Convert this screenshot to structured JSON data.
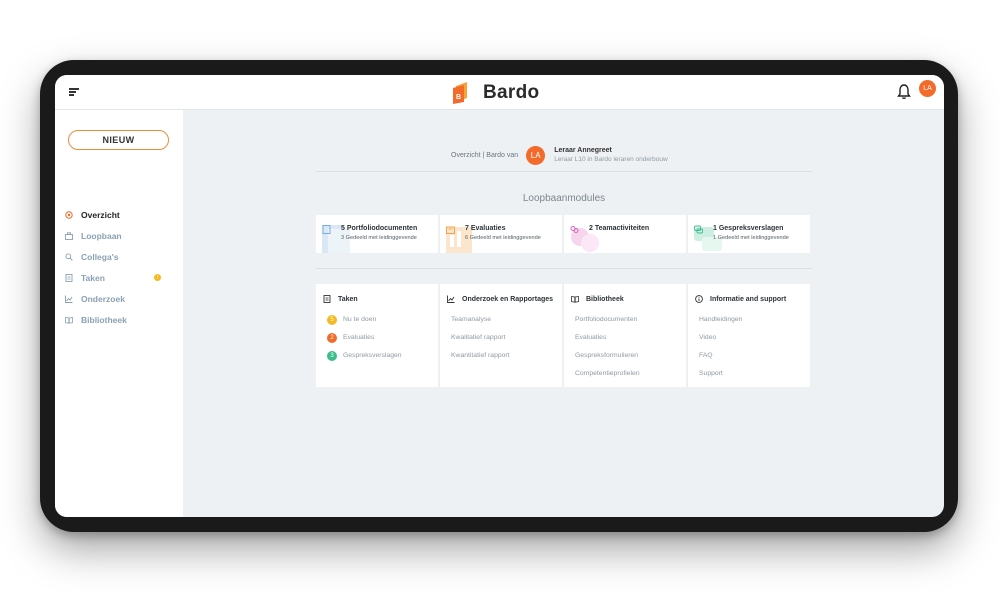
{
  "app": {
    "brand": "Bardo"
  },
  "header": {
    "avatar_initials": "LA"
  },
  "colors": {
    "accent": "#f26b2a",
    "button_border": "#f08a3c",
    "badge_yellow": "#f5b921",
    "green": "#3dbd8c",
    "screen_bg": "#eef1f3"
  },
  "sidebar": {
    "new_button": "NIEUW",
    "items": [
      {
        "label": "Overzicht",
        "icon": "target-icon",
        "active": true
      },
      {
        "label": "Loopbaan",
        "icon": "briefcase-icon"
      },
      {
        "label": "Collega's",
        "icon": "search-icon"
      },
      {
        "label": "Taken",
        "icon": "task-list-icon",
        "badge": "!"
      },
      {
        "label": "Onderzoek",
        "icon": "chart-icon"
      },
      {
        "label": "Bibliotheek",
        "icon": "book-icon"
      }
    ]
  },
  "overview": {
    "breadcrumb": "Overzicht | Bardo van",
    "user": {
      "initials": "LA",
      "name": "Leraar Annegreet",
      "subtitle": "Leraar L10 in Bardo leraren onderbouw"
    }
  },
  "modules": {
    "title": "Loopbaanmodules",
    "cards": [
      {
        "title": "5 Portfoliodocumenten",
        "sub": "3 Gedeeld met leidinggevende",
        "icon": "document-icon",
        "color": "#6fa8dc"
      },
      {
        "title": "7 Evaluaties",
        "sub": "6 Gedeeld met leidinggevende",
        "icon": "evaluation-icon",
        "color": "#f39c3c"
      },
      {
        "title": "2 Teamactiviteiten",
        "sub": "",
        "icon": "team-icon",
        "color": "#e05ab8"
      },
      {
        "title": "1 Gespreksverslagen",
        "sub": "1 Gedeeld met leidinggevende",
        "icon": "conversation-icon",
        "color": "#3dbd8c"
      }
    ]
  },
  "links": [
    {
      "title": "Taken",
      "icon": "task-list-icon",
      "items": [
        {
          "label": "Nu te doen",
          "count": "5",
          "color": "#f5b921"
        },
        {
          "label": "Evaluaties",
          "count": "2",
          "color": "#f26b2a"
        },
        {
          "label": "Gespreksverslagen",
          "count": "3",
          "color": "#3dbd8c"
        }
      ]
    },
    {
      "title": "Onderzoek en Rapportages",
      "icon": "chart-icon",
      "items": [
        {
          "label": "Teamanalyse"
        },
        {
          "label": "Kwalitatief rapport"
        },
        {
          "label": "Kwantitatief rapport"
        }
      ]
    },
    {
      "title": "Bibliotheek",
      "icon": "book-icon",
      "items": [
        {
          "label": "Portfoliodocumenten"
        },
        {
          "label": "Evaluaties"
        },
        {
          "label": "Gespreksformulieren"
        },
        {
          "label": "Competentieprofielen"
        }
      ]
    },
    {
      "title": "Informatie and support",
      "icon": "info-icon",
      "items": [
        {
          "label": "Handleidingen"
        },
        {
          "label": "Video"
        },
        {
          "label": "FAQ"
        },
        {
          "label": "Support"
        }
      ]
    }
  ]
}
